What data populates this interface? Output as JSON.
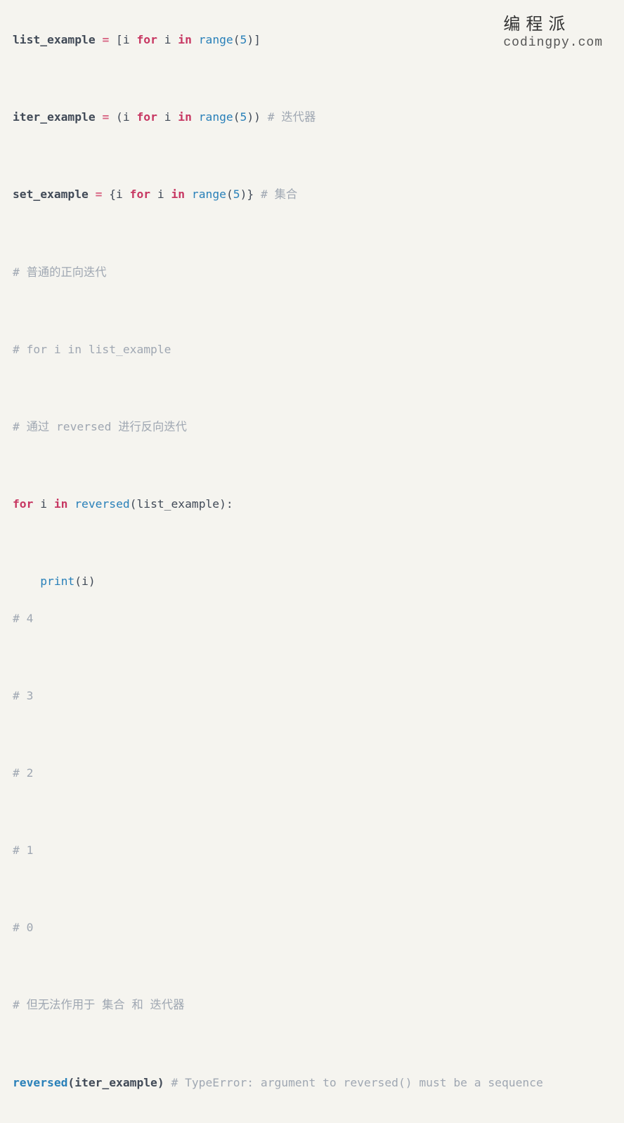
{
  "watermark": {
    "cn": "编程派",
    "en": "codingpy.com"
  },
  "code": {
    "l1": {
      "a": "list_example ",
      "b": "= ",
      "c": "[i ",
      "d": "for ",
      "e": "i ",
      "f": "in ",
      "g": "range",
      "h": "(",
      "i": "5",
      "j": ")]"
    },
    "l2": {
      "a": "iter_example ",
      "b": "= ",
      "c": "(i ",
      "d": "for ",
      "e": "i ",
      "f": "in ",
      "g": "range",
      "h": "(",
      "i": "5",
      "j": ")) ",
      "k": "# 迭代器"
    },
    "l3": {
      "a": "set_example ",
      "b": "= ",
      "c": "{i ",
      "d": "for ",
      "e": "i ",
      "f": "in ",
      "g": "range",
      "h": "(",
      "i": "5",
      "j": ")} ",
      "k": "# 集合"
    },
    "c1": "# 普通的正向迭代",
    "c2": "# for i in list_example",
    "c3": "# 通过 reversed 进行反向迭代",
    "l4": {
      "a": "for ",
      "b": "i ",
      "c": "in ",
      "d": "reversed",
      "e": "(list_example):"
    },
    "l5": {
      "a": "    ",
      "b": "print",
      "c": "(i)"
    },
    "o4": "# 4",
    "o3": "# 3",
    "o2": "# 2",
    "o1": "# 1",
    "o0": "# 0",
    "c4": "# 但无法作用于 集合 和 迭代器",
    "l6": {
      "a": "reversed",
      "b": "(iter_example) ",
      "c": "# TypeError: argument to reversed() must be a sequence"
    }
  }
}
